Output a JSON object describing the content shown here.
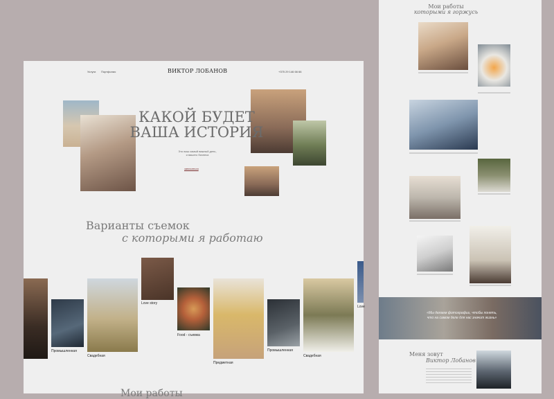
{
  "header": {
    "nav_item_1": "Услуги",
    "nav_item_2": "Портфолио",
    "logo": "ВИКТОР ЛОБАНОВ",
    "phone": "+375 29 146 66 66"
  },
  "hero": {
    "title_line_1": "КАКОЙ БУДЕТ",
    "title_line_2": "ВАША ИСТОРИЯ",
    "subtitle_line_1": "Это ваш самый важный день,",
    "subtitle_line_2": "и вашего бизнеса",
    "cta": "записаться"
  },
  "services": {
    "title_line_1": "Варианты съемок",
    "title_line_2": "с которыми я работаю",
    "items": [
      {
        "label": "Промышленная"
      },
      {
        "label": "Свадебная"
      },
      {
        "label": "Love story"
      },
      {
        "label": "Food - съемка"
      },
      {
        "label": "Предметная"
      },
      {
        "label": "Промышленная"
      },
      {
        "label": "Свадебная"
      },
      {
        "label": "Love"
      }
    ]
  },
  "works_peek": "Мои работы",
  "right": {
    "title_line_1": "Мои работы",
    "title_line_2": "которыми я горжусь",
    "banner_line_1": "«Мы делаем фотографии, чтобы понять,",
    "banner_line_2": "что на самом деле для нас значит жизнь»",
    "about_title_1": "Меня зовут",
    "about_title_2": "Виктор Лобанов"
  },
  "colors": {
    "page_bg": "#b7adae",
    "panel_bg": "#efefef",
    "accent": "#7a2e2e",
    "heading": "#6b6b6b"
  }
}
